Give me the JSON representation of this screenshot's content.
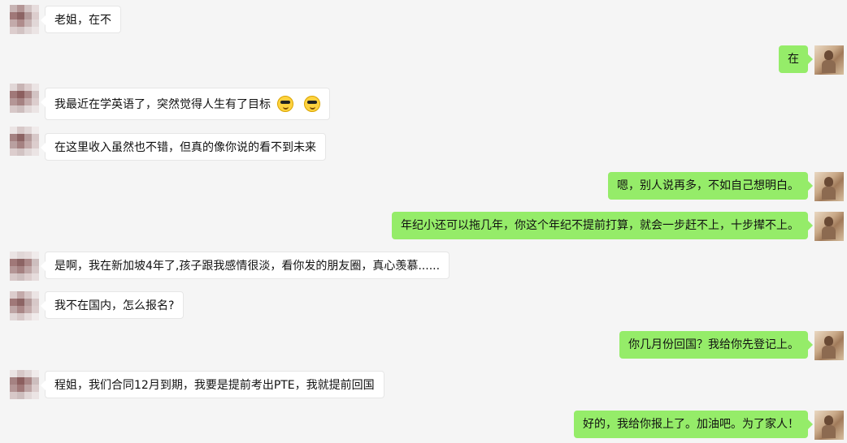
{
  "messages": [
    {
      "side": "left",
      "text": "老姐，在不"
    },
    {
      "side": "right",
      "text": "在"
    },
    {
      "side": "left",
      "text": "我最近在学英语了，突然觉得人生有了目标",
      "emoji": [
        "cool-emoji",
        "cool-emoji"
      ]
    },
    {
      "side": "left",
      "text": "在这里收入虽然也不错，但真的像你说的看不到未来"
    },
    {
      "side": "right",
      "text": "嗯，别人说再多，不如自己想明白。"
    },
    {
      "side": "right",
      "text": "年纪小还可以拖几年，你这个年纪不提前打算，就会一步赶不上，十步撵不上。"
    },
    {
      "side": "left",
      "text": "是啊，我在新加坡4年了,孩子跟我感情很淡，看你发的朋友圈，真心羡慕......"
    },
    {
      "side": "left",
      "text": "我不在国内，怎么报名?"
    },
    {
      "side": "right",
      "text": "你几月份回国？我给你先登记上。"
    },
    {
      "side": "left",
      "text": "程姐，我们合同12月到期，我要是提前考出PTE，我就提前回国"
    },
    {
      "side": "right",
      "text": "好的，我给你报上了。加油吧。为了家人！"
    }
  ],
  "colors": {
    "background": "#f5f5f5",
    "self_bubble": "#95ec69",
    "other_bubble": "#ffffff"
  }
}
